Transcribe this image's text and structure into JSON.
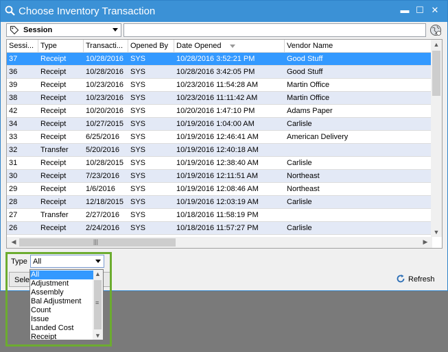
{
  "window": {
    "title": "Choose Inventory Transaction",
    "minimize": "▬",
    "maximize": "☐",
    "close": "✕",
    "title_bar_color": "#3b91d6"
  },
  "toolbar": {
    "session_combo_value": "Session",
    "search_value": "",
    "icons": [
      "search-icon",
      "tag-icon",
      "globe-icon"
    ]
  },
  "grid": {
    "columns": [
      "Sessi...",
      "Type",
      "Transacti...",
      "Opened By",
      "Date Opened",
      "Vendor Name"
    ],
    "sorted_column": "Date Opened",
    "selected_row_color": "#3399ff",
    "alt_row_color": "#e3e9f6",
    "rows": [
      [
        "37",
        "Receipt",
        "10/28/2016",
        "SYS",
        "10/28/2016 3:52:21 PM",
        "Good Stuff"
      ],
      [
        "36",
        "Receipt",
        "10/28/2016",
        "SYS",
        "10/28/2016 3:42:05 PM",
        "Good Stuff"
      ],
      [
        "39",
        "Receipt",
        "10/23/2016",
        "SYS",
        "10/23/2016 11:54:28 AM",
        "Martin Office"
      ],
      [
        "38",
        "Receipt",
        "10/23/2016",
        "SYS",
        "10/23/2016 11:11:42 AM",
        "Martin Office"
      ],
      [
        "42",
        "Receipt",
        "10/20/2016",
        "SYS",
        "10/20/2016 1:47:10 PM",
        "Adams Paper"
      ],
      [
        "34",
        "Receipt",
        "10/27/2015",
        "SYS",
        "10/19/2016 1:04:00 AM",
        "Carlisle"
      ],
      [
        "33",
        "Receipt",
        "6/25/2016",
        "SYS",
        "10/19/2016 12:46:41 AM",
        "American Delivery"
      ],
      [
        "32",
        "Transfer",
        "5/20/2016",
        "SYS",
        "10/19/2016 12:40:18 AM",
        ""
      ],
      [
        "31",
        "Receipt",
        "10/28/2015",
        "SYS",
        "10/19/2016 12:38:40 AM",
        "Carlisle"
      ],
      [
        "30",
        "Receipt",
        "7/23/2016",
        "SYS",
        "10/19/2016 12:11:51 AM",
        "Northeast"
      ],
      [
        "29",
        "Receipt",
        "1/6/2016",
        "SYS",
        "10/19/2016 12:08:46 AM",
        "Northeast"
      ],
      [
        "28",
        "Receipt",
        "12/18/2015",
        "SYS",
        "10/19/2016 12:03:19 AM",
        "Carlisle"
      ],
      [
        "27",
        "Transfer",
        "2/27/2016",
        "SYS",
        "10/18/2016 11:58:19 PM",
        ""
      ],
      [
        "26",
        "Receipt",
        "2/24/2016",
        "SYS",
        "10/18/2016 11:57:27 PM",
        "Carlisle"
      ]
    ],
    "selected_row_index": 0
  },
  "filter": {
    "type_label": "Type",
    "type_value": "All",
    "options": [
      "All",
      "Adjustment",
      "Assembly",
      "Bal Adjustment",
      "Count",
      "Issue",
      "Landed Cost",
      "Receipt"
    ],
    "selected_option_index": 0,
    "highlight_color": "#6cac2f"
  },
  "bottom": {
    "select_label": "Sele",
    "refresh_label": "Refresh"
  }
}
